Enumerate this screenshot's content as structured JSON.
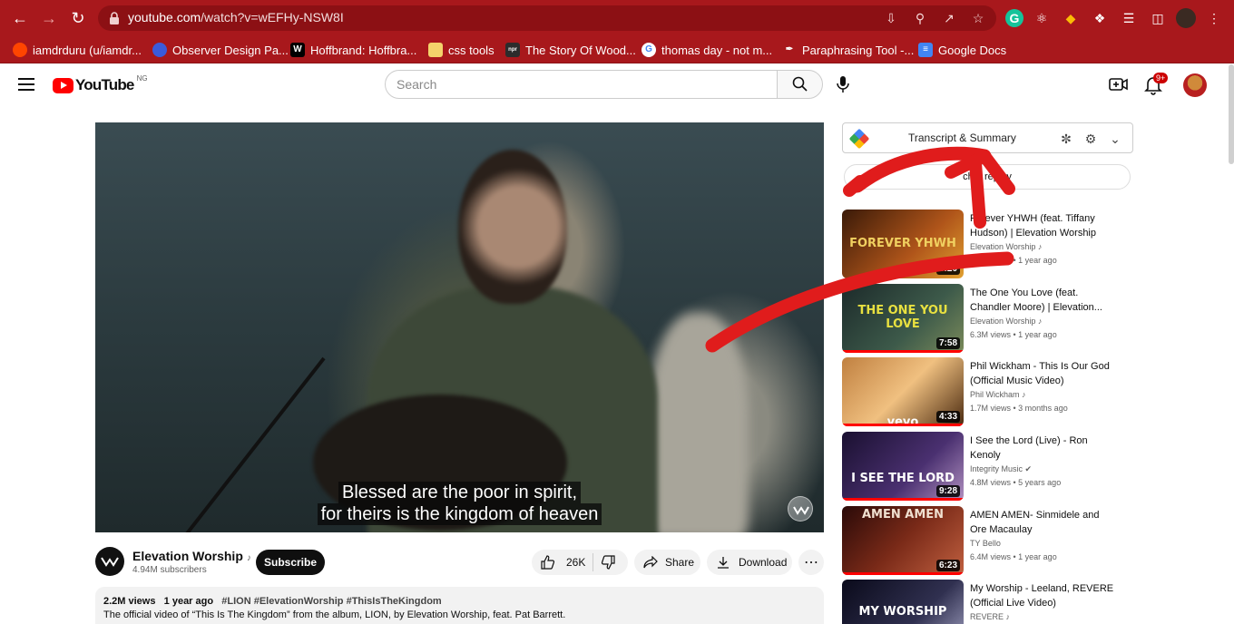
{
  "browser": {
    "url_host": "youtube.com",
    "url_path": "/watch?v=wEFHy-NSW8I",
    "bookmarks": [
      {
        "label": "iamdrduru (u/iamdr...",
        "icon": "reddit-icon",
        "color": "#ff4500"
      },
      {
        "label": "Observer Design Pa...",
        "icon": "circle-logo-icon",
        "color": "#3b5bdb"
      },
      {
        "label": "Hoffbrand: Hoffbra...",
        "icon": "w-logo-icon",
        "color": "#000000"
      },
      {
        "label": "css tools",
        "icon": "folder-icon",
        "color": "#f4d36b"
      },
      {
        "label": "The Story Of Wood...",
        "icon": "npr-icon",
        "color": "#2c2c2c"
      },
      {
        "label": "thomas day - not m...",
        "icon": "google-icon",
        "color": "#ffffff"
      },
      {
        "label": "Paraphrasing Tool -...",
        "icon": "quill-icon",
        "color": "#ffffff"
      },
      {
        "label": "Google Docs",
        "icon": "docs-icon",
        "color": "#4285f4"
      }
    ]
  },
  "youtube": {
    "logo_text": "YouTube",
    "country_code": "NG",
    "search_placeholder": "Search",
    "notification_count": "9+"
  },
  "video": {
    "caption_line1": "Blessed are the poor in spirit,",
    "caption_line2": "for theirs is the kingdom of heaven",
    "channel_name": "Elevation Worship",
    "subscribers": "4.94M subscribers",
    "subscribe_label": "Subscribe",
    "likes": "26K",
    "share_label": "Share",
    "download_label": "Download",
    "views": "2.2M views",
    "posted": "1 year ago",
    "tags": "#LION #ElevationWorship #ThisIsTheKingdom",
    "description": "The official video of “This Is The Kingdom” from the album, LION, by Elevation Worship, feat. Pat Barrett."
  },
  "sidebar": {
    "transcript_title": "Transcript & Summary",
    "chat_replay_label": "chat replay",
    "recommendations": [
      {
        "title": "Forever YHWH (feat. Tiffany Hudson) | Elevation Worship",
        "channel": "Elevation Worship",
        "views": "2.7M views",
        "age": "1 year ago",
        "duration": "8:20",
        "thumb_text": "FOREVER YHWH",
        "verified": false,
        "music": true,
        "progress": 0
      },
      {
        "title": "The One You Love (feat. Chandler Moore) | Elevation...",
        "channel": "Elevation Worship",
        "views": "6.3M views",
        "age": "1 year ago",
        "duration": "7:58",
        "thumb_text": "THE ONE YOU LOVE",
        "verified": false,
        "music": true,
        "progress": 1.0
      },
      {
        "title": "Phil Wickham - This Is Our God (Official Music Video)",
        "channel": "Phil Wickham",
        "views": "1.7M views",
        "age": "3 months ago",
        "duration": "4:33",
        "thumb_text": "vevo",
        "verified": false,
        "music": true,
        "progress": 1.0
      },
      {
        "title": "I See the Lord (Live) - Ron Kenoly",
        "channel": "Integrity Music",
        "views": "4.8M views",
        "age": "5 years ago",
        "duration": "9:28",
        "thumb_text": "I SEE THE LORD",
        "verified": true,
        "music": false,
        "progress": 1.0
      },
      {
        "title": "AMEN AMEN- Sinmidele and Ore Macaulay",
        "channel": "TY Bello",
        "views": "6.4M views",
        "age": "1 year ago",
        "duration": "6:23",
        "thumb_text": "AMEN AMEN",
        "verified": false,
        "music": false,
        "progress": 1.0
      },
      {
        "title": "My Worship - Leeland, REVERE (Official Live Video)",
        "channel": "REVERE",
        "views": "",
        "age": "",
        "duration": "",
        "thumb_text": "MY WORSHIP",
        "verified": false,
        "music": true,
        "progress": 0
      }
    ]
  }
}
